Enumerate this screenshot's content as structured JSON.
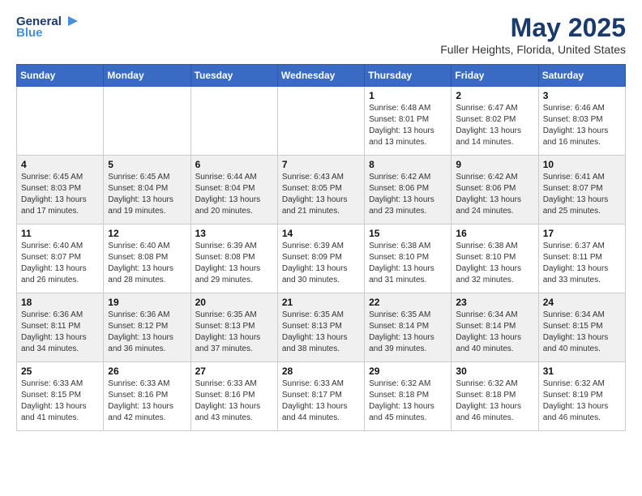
{
  "header": {
    "logo_line1": "General",
    "logo_line2": "Blue",
    "month": "May 2025",
    "location": "Fuller Heights, Florida, United States"
  },
  "weekdays": [
    "Sunday",
    "Monday",
    "Tuesday",
    "Wednesday",
    "Thursday",
    "Friday",
    "Saturday"
  ],
  "weeks": [
    [
      {
        "day": "",
        "info": ""
      },
      {
        "day": "",
        "info": ""
      },
      {
        "day": "",
        "info": ""
      },
      {
        "day": "",
        "info": ""
      },
      {
        "day": "1",
        "info": "Sunrise: 6:48 AM\nSunset: 8:01 PM\nDaylight: 13 hours\nand 13 minutes."
      },
      {
        "day": "2",
        "info": "Sunrise: 6:47 AM\nSunset: 8:02 PM\nDaylight: 13 hours\nand 14 minutes."
      },
      {
        "day": "3",
        "info": "Sunrise: 6:46 AM\nSunset: 8:03 PM\nDaylight: 13 hours\nand 16 minutes."
      }
    ],
    [
      {
        "day": "4",
        "info": "Sunrise: 6:45 AM\nSunset: 8:03 PM\nDaylight: 13 hours\nand 17 minutes."
      },
      {
        "day": "5",
        "info": "Sunrise: 6:45 AM\nSunset: 8:04 PM\nDaylight: 13 hours\nand 19 minutes."
      },
      {
        "day": "6",
        "info": "Sunrise: 6:44 AM\nSunset: 8:04 PM\nDaylight: 13 hours\nand 20 minutes."
      },
      {
        "day": "7",
        "info": "Sunrise: 6:43 AM\nSunset: 8:05 PM\nDaylight: 13 hours\nand 21 minutes."
      },
      {
        "day": "8",
        "info": "Sunrise: 6:42 AM\nSunset: 8:06 PM\nDaylight: 13 hours\nand 23 minutes."
      },
      {
        "day": "9",
        "info": "Sunrise: 6:42 AM\nSunset: 8:06 PM\nDaylight: 13 hours\nand 24 minutes."
      },
      {
        "day": "10",
        "info": "Sunrise: 6:41 AM\nSunset: 8:07 PM\nDaylight: 13 hours\nand 25 minutes."
      }
    ],
    [
      {
        "day": "11",
        "info": "Sunrise: 6:40 AM\nSunset: 8:07 PM\nDaylight: 13 hours\nand 26 minutes."
      },
      {
        "day": "12",
        "info": "Sunrise: 6:40 AM\nSunset: 8:08 PM\nDaylight: 13 hours\nand 28 minutes."
      },
      {
        "day": "13",
        "info": "Sunrise: 6:39 AM\nSunset: 8:08 PM\nDaylight: 13 hours\nand 29 minutes."
      },
      {
        "day": "14",
        "info": "Sunrise: 6:39 AM\nSunset: 8:09 PM\nDaylight: 13 hours\nand 30 minutes."
      },
      {
        "day": "15",
        "info": "Sunrise: 6:38 AM\nSunset: 8:10 PM\nDaylight: 13 hours\nand 31 minutes."
      },
      {
        "day": "16",
        "info": "Sunrise: 6:38 AM\nSunset: 8:10 PM\nDaylight: 13 hours\nand 32 minutes."
      },
      {
        "day": "17",
        "info": "Sunrise: 6:37 AM\nSunset: 8:11 PM\nDaylight: 13 hours\nand 33 minutes."
      }
    ],
    [
      {
        "day": "18",
        "info": "Sunrise: 6:36 AM\nSunset: 8:11 PM\nDaylight: 13 hours\nand 34 minutes."
      },
      {
        "day": "19",
        "info": "Sunrise: 6:36 AM\nSunset: 8:12 PM\nDaylight: 13 hours\nand 36 minutes."
      },
      {
        "day": "20",
        "info": "Sunrise: 6:35 AM\nSunset: 8:13 PM\nDaylight: 13 hours\nand 37 minutes."
      },
      {
        "day": "21",
        "info": "Sunrise: 6:35 AM\nSunset: 8:13 PM\nDaylight: 13 hours\nand 38 minutes."
      },
      {
        "day": "22",
        "info": "Sunrise: 6:35 AM\nSunset: 8:14 PM\nDaylight: 13 hours\nand 39 minutes."
      },
      {
        "day": "23",
        "info": "Sunrise: 6:34 AM\nSunset: 8:14 PM\nDaylight: 13 hours\nand 40 minutes."
      },
      {
        "day": "24",
        "info": "Sunrise: 6:34 AM\nSunset: 8:15 PM\nDaylight: 13 hours\nand 40 minutes."
      }
    ],
    [
      {
        "day": "25",
        "info": "Sunrise: 6:33 AM\nSunset: 8:15 PM\nDaylight: 13 hours\nand 41 minutes."
      },
      {
        "day": "26",
        "info": "Sunrise: 6:33 AM\nSunset: 8:16 PM\nDaylight: 13 hours\nand 42 minutes."
      },
      {
        "day": "27",
        "info": "Sunrise: 6:33 AM\nSunset: 8:16 PM\nDaylight: 13 hours\nand 43 minutes."
      },
      {
        "day": "28",
        "info": "Sunrise: 6:33 AM\nSunset: 8:17 PM\nDaylight: 13 hours\nand 44 minutes."
      },
      {
        "day": "29",
        "info": "Sunrise: 6:32 AM\nSunset: 8:18 PM\nDaylight: 13 hours\nand 45 minutes."
      },
      {
        "day": "30",
        "info": "Sunrise: 6:32 AM\nSunset: 8:18 PM\nDaylight: 13 hours\nand 46 minutes."
      },
      {
        "day": "31",
        "info": "Sunrise: 6:32 AM\nSunset: 8:19 PM\nDaylight: 13 hours\nand 46 minutes."
      }
    ]
  ]
}
